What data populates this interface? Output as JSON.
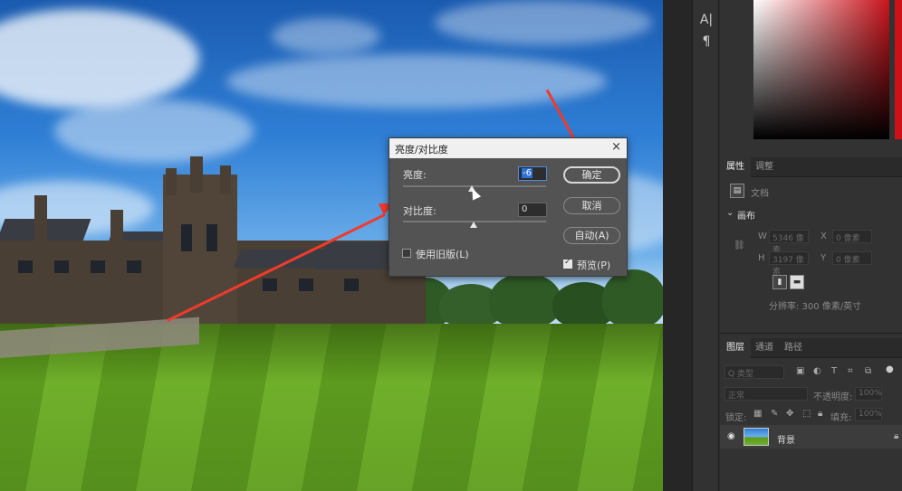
{
  "dialog": {
    "title": "亮度/对比度",
    "close": "×",
    "brightness_label": "亮度:",
    "brightness_value": "-6",
    "contrast_label": "对比度:",
    "contrast_value": "0",
    "legacy_label": "使用旧版(L)",
    "legacy_checked": false,
    "preview_label": "预览(P)",
    "preview_checked": true,
    "ok_label": "确定",
    "cancel_label": "取消",
    "auto_label": "自动(A)"
  },
  "toolstrip": {
    "glyph_type": "A|",
    "glyph_paragraph": "¶"
  },
  "properties": {
    "tab_properties": "属性",
    "tab_adjustments": "调整",
    "doc_label": "文档",
    "canvas_section": "画布",
    "w_label": "W",
    "w_value": "5346 像素",
    "h_label": "H",
    "h_value": "3197 像素",
    "x_label": "X",
    "x_value": "0 像素",
    "y_label": "Y",
    "y_value": "0 像素",
    "resolution": "分辨率: 300 像素/英寸"
  },
  "layers": {
    "tab_layers": "图层",
    "tab_channels": "通道",
    "tab_paths": "路径",
    "kind_filter": "Q 类型",
    "blend_mode": "正常",
    "opacity_label": "不透明度:",
    "opacity_value": "100%",
    "lock_label": "锁定:",
    "fill_label": "填充:",
    "fill_value": "100%",
    "layer_name": "背景"
  },
  "colors": {
    "arrow": "#f03b2b",
    "dialog_bg": "#535353",
    "panel_bg": "#323232"
  }
}
